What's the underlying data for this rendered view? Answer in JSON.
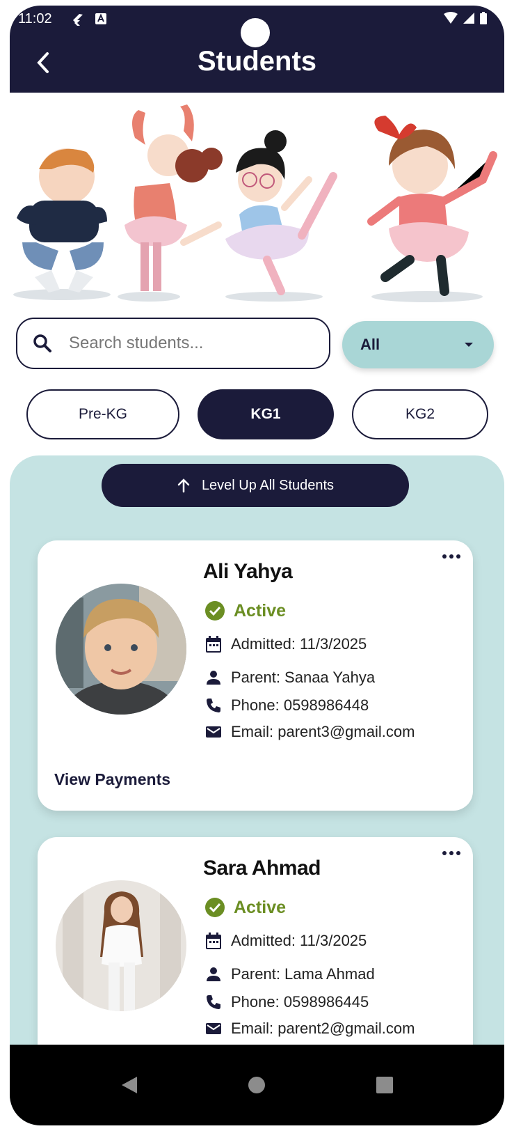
{
  "status_bar": {
    "time": "11:02"
  },
  "header": {
    "title": "Students"
  },
  "search": {
    "placeholder": "Search students..."
  },
  "filter": {
    "selected": "All"
  },
  "levels": [
    "Pre-KG",
    "KG1",
    "KG2"
  ],
  "selected_level": "KG1",
  "actions": {
    "level_up_label": "Level Up All Students"
  },
  "students": [
    {
      "name": "Ali Yahya",
      "status": "Active",
      "admitted": "Admitted: 11/3/2025",
      "parent": "Parent: Sanaa Yahya",
      "phone": "Phone: 0598986448",
      "email": "Email: parent3@gmail.com",
      "link": "View Payments"
    },
    {
      "name": "Sara Ahmad",
      "status": "Active",
      "admitted": "Admitted: 11/3/2025",
      "parent": "Parent: Lama Ahmad",
      "phone": "Phone: 0598986445",
      "email": "Email: parent2@gmail.com"
    }
  ],
  "colors": {
    "primary": "#1b1b3a",
    "accent": "#a9d6d6",
    "panel": "#c5e3e3",
    "active": "#6b8e23"
  }
}
